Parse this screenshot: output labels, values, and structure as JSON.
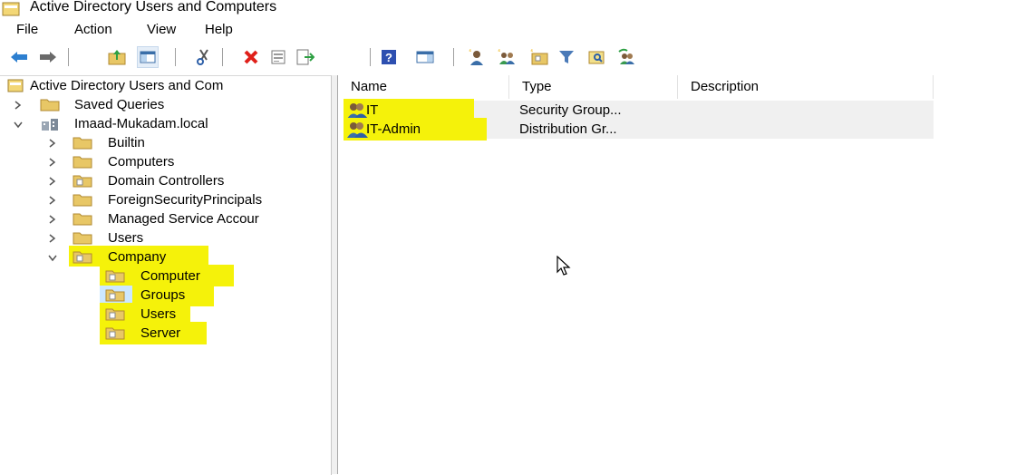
{
  "window": {
    "title": "Active Directory Users and Computers"
  },
  "menu": [
    "File",
    "Action",
    "View",
    "Help"
  ],
  "toolbar": {
    "buttons": [
      "back-icon",
      "forward-icon",
      "up-folder-icon",
      "show-hide-console-tree-icon",
      "cut-icon",
      "delete-icon",
      "properties-icon",
      "export-list-icon",
      "help-icon",
      "action-pane-icon",
      "new-user-icon",
      "new-group-icon",
      "new-ou-icon",
      "filter-icon",
      "find-icon",
      "add-to-group-icon"
    ]
  },
  "tree": {
    "root": "Active Directory Users and Com",
    "saved_queries": "Saved Queries",
    "domain": "Imaad-Mukadam.local",
    "builtin": "Builtin",
    "computers": "Computers",
    "domain_controllers": "Domain Controllers",
    "foreign": "ForeignSecurityPrincipals",
    "managed": "Managed Service Accour",
    "users": "Users",
    "company": "Company",
    "company_children": [
      "Computer",
      "Groups",
      "Users",
      "Server"
    ],
    "selected": "Groups"
  },
  "list": {
    "columns": [
      "Name",
      "Type",
      "Description"
    ],
    "rows": [
      {
        "name": "IT",
        "type": "Security Group...",
        "description": ""
      },
      {
        "name": "IT-Admin",
        "type": "Distribution Gr...",
        "description": ""
      }
    ]
  },
  "colors": {
    "highlight": "#f5f20a",
    "selection": "#cce8ff",
    "folder": "#e8c766"
  }
}
